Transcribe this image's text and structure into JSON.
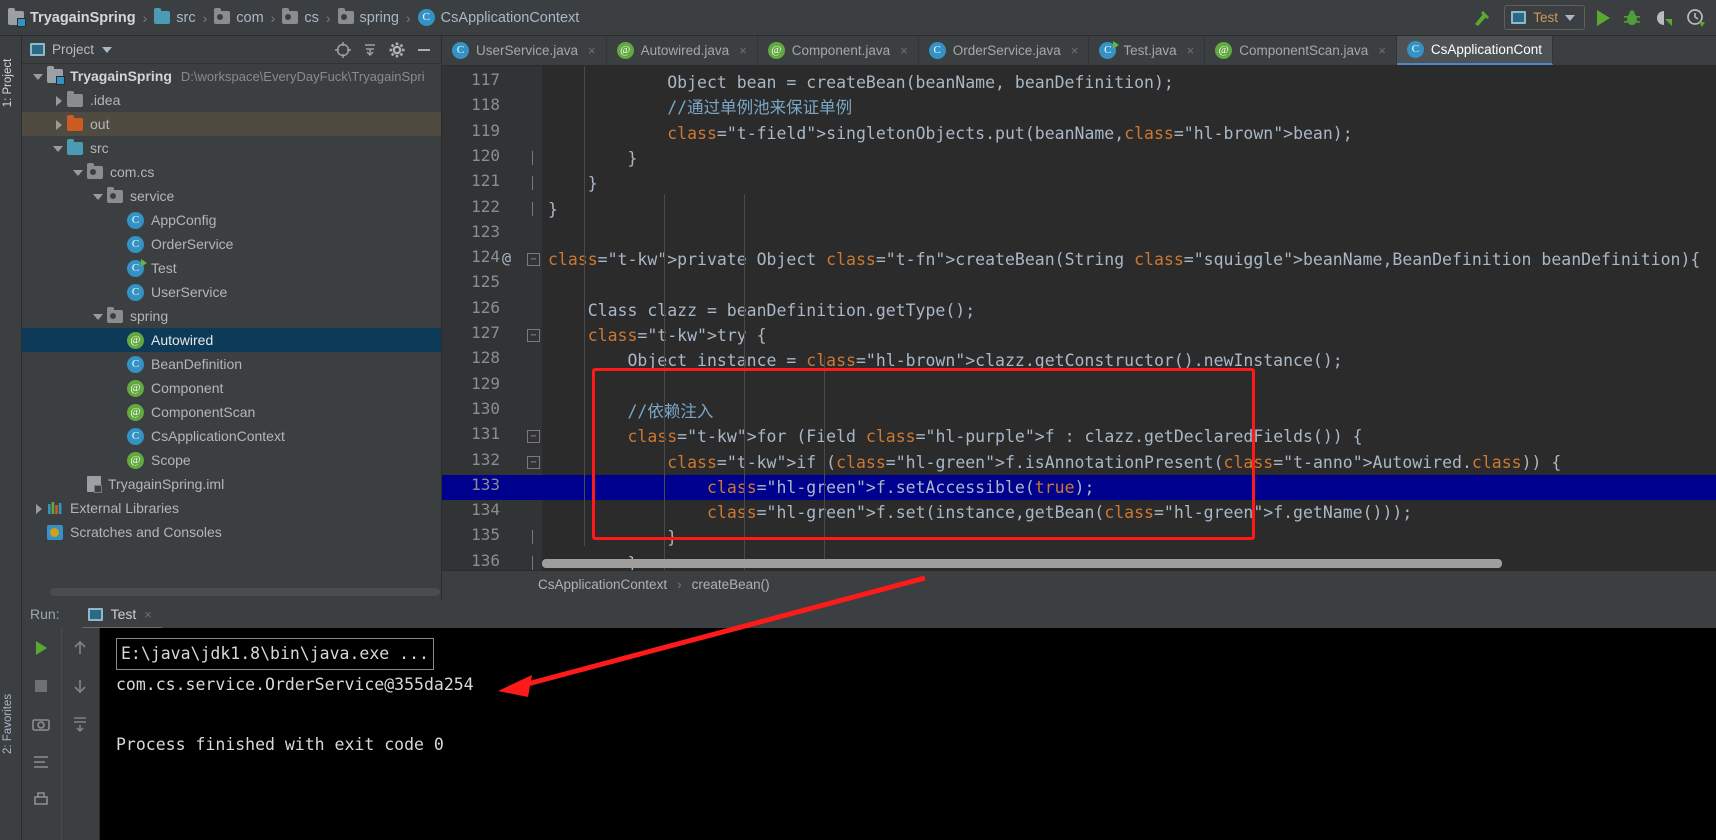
{
  "window": {
    "breadcrumbs": [
      {
        "label": "TryagainSpring",
        "icon": "module-root-icon"
      },
      {
        "label": "src",
        "icon": "folder-blue-icon"
      },
      {
        "label": "com",
        "icon": "package-icon"
      },
      {
        "label": "cs",
        "icon": "package-icon"
      },
      {
        "label": "spring",
        "icon": "package-icon"
      },
      {
        "label": "CsApplicationContext",
        "icon": "class-icon"
      }
    ],
    "separator": "›"
  },
  "toolbar": {
    "build_icon": "hammer-icon",
    "run_config": "Test",
    "run_config_icon": "run-config-icon",
    "dropdown_icon": "chevron-down-icon",
    "run_icon": "run-play-icon",
    "debug_icon": "debug-bug-icon",
    "run_coverage_icon": "run-coverage-icon",
    "profile_icon": "profiler-icon"
  },
  "left_strip": {
    "top_tab": "1: Project",
    "bottom_tab": "2: Favorites"
  },
  "project_panel": {
    "title": "Project",
    "title_caret": "chevron-down-icon",
    "header_icons": [
      "locate-icon",
      "collapse-all-icon",
      "settings-gear-icon",
      "hide-icon"
    ],
    "tree": [
      {
        "label": "TryagainSpring",
        "path": "D:\\workspace\\EveryDayFuck\\TryagainSpri",
        "indent": 0,
        "arrow": "open",
        "icon": "module-root-icon",
        "bold": true,
        "state": "none"
      },
      {
        "label": ".idea",
        "indent": 1,
        "arrow": "closed",
        "icon": "folder-gray-icon",
        "state": "none"
      },
      {
        "label": "out",
        "indent": 1,
        "arrow": "closed",
        "icon": "folder-orange-icon",
        "state": "gray"
      },
      {
        "label": "src",
        "indent": 1,
        "arrow": "open",
        "icon": "folder-blue-icon",
        "state": "none"
      },
      {
        "label": "com.cs",
        "indent": 2,
        "arrow": "open",
        "icon": "package-icon",
        "state": "none"
      },
      {
        "label": "service",
        "indent": 3,
        "arrow": "open",
        "icon": "package-icon",
        "state": "none"
      },
      {
        "label": "AppConfig",
        "indent": 4,
        "arrow": "none",
        "icon": "class-icon",
        "state": "none"
      },
      {
        "label": "OrderService",
        "indent": 4,
        "arrow": "none",
        "icon": "class-icon",
        "state": "none"
      },
      {
        "label": "Test",
        "indent": 4,
        "arrow": "none",
        "icon": "class-runnable-icon",
        "state": "none"
      },
      {
        "label": "UserService",
        "indent": 4,
        "arrow": "none",
        "icon": "class-icon",
        "state": "none"
      },
      {
        "label": "spring",
        "indent": 3,
        "arrow": "open",
        "icon": "package-icon",
        "state": "none"
      },
      {
        "label": "Autowired",
        "indent": 4,
        "arrow": "none",
        "icon": "annotation-icon",
        "state": "blue"
      },
      {
        "label": "BeanDefinition",
        "indent": 4,
        "arrow": "none",
        "icon": "class-icon",
        "state": "none"
      },
      {
        "label": "Component",
        "indent": 4,
        "arrow": "none",
        "icon": "annotation-icon",
        "state": "none"
      },
      {
        "label": "ComponentScan",
        "indent": 4,
        "arrow": "none",
        "icon": "annotation-icon",
        "state": "none"
      },
      {
        "label": "CsApplicationContext",
        "indent": 4,
        "arrow": "none",
        "icon": "class-icon",
        "state": "none"
      },
      {
        "label": "Scope",
        "indent": 4,
        "arrow": "none",
        "icon": "annotation-icon",
        "state": "none"
      },
      {
        "label": "TryagainSpring.iml",
        "indent": 2,
        "arrow": "none",
        "icon": "iml-file-icon",
        "state": "none"
      },
      {
        "label": "External Libraries",
        "indent": 0,
        "arrow": "closed",
        "icon": "library-icon",
        "state": "none"
      },
      {
        "label": "Scratches and Consoles",
        "indent": 0,
        "arrow": "none",
        "icon": "scratches-icon",
        "state": "none"
      }
    ]
  },
  "editor_tabs": [
    {
      "label": "UserService.java",
      "icon": "class-icon",
      "active": false,
      "close": "×"
    },
    {
      "label": "Autowired.java",
      "icon": "annotation-icon",
      "active": false,
      "close": "×"
    },
    {
      "label": "Component.java",
      "icon": "annotation-icon",
      "active": false,
      "close": "×"
    },
    {
      "label": "OrderService.java",
      "icon": "class-icon",
      "active": false,
      "close": "×"
    },
    {
      "label": "Test.java",
      "icon": "class-runnable-icon",
      "active": false,
      "close": "×"
    },
    {
      "label": "ComponentScan.java",
      "icon": "annotation-icon",
      "active": false,
      "close": "×"
    },
    {
      "label": "CsApplicationCont",
      "icon": "class-icon",
      "active": true,
      "close": ""
    }
  ],
  "editor": {
    "first_line": 117,
    "caret_line": 133,
    "lines": [
      {
        "n": 117,
        "text": "            Object bean = createBean(beanName, beanDefinition);"
      },
      {
        "n": 118,
        "text": "            //通过单例池来保证单例"
      },
      {
        "n": 119,
        "text": "            singletonObjects.put(beanName,bean);"
      },
      {
        "n": 120,
        "text": "        }"
      },
      {
        "n": 121,
        "text": "    }"
      },
      {
        "n": 122,
        "text": "}"
      },
      {
        "n": 123,
        "text": ""
      },
      {
        "n": 124,
        "text": "private Object createBean(String beanName,BeanDefinition beanDefinition){"
      },
      {
        "n": 125,
        "text": ""
      },
      {
        "n": 126,
        "text": "    Class clazz = beanDefinition.getType();"
      },
      {
        "n": 127,
        "text": "    try {"
      },
      {
        "n": 128,
        "text": "        Object instance = clazz.getConstructor().newInstance();"
      },
      {
        "n": 129,
        "text": ""
      },
      {
        "n": 130,
        "text": "        //依赖注入"
      },
      {
        "n": 131,
        "text": "        for (Field f : clazz.getDeclaredFields()) {"
      },
      {
        "n": 132,
        "text": "            if (f.isAnnotationPresent(Autowired.class)) {"
      },
      {
        "n": 133,
        "text": "                f.setAccessible(true);"
      },
      {
        "n": 134,
        "text": "                f.set(instance,getBean(f.getName()));"
      },
      {
        "n": 135,
        "text": "            }"
      },
      {
        "n": 136,
        "text": "        }"
      }
    ],
    "annotation_marker": "@",
    "highlights": {
      "bean_occurrence": "bean",
      "constructor_call": "clazz.getConstructor",
      "field_var": "f"
    }
  },
  "editor_breadcrumbs": {
    "items": [
      "CsApplicationContext",
      "createBean()"
    ],
    "separator": "›"
  },
  "run_panel": {
    "label": "Run:",
    "tab": "Test",
    "tab_icon": "run-config-icon",
    "tab_close": "×",
    "side_icons": [
      "rerun-play-icon",
      "stop-square-icon",
      "camera-icon",
      "soft-wrap-icon",
      "scroll-to-end-icon",
      "up-arrow-icon",
      "down-arrow-icon",
      "print-icon"
    ],
    "console": [
      {
        "text": "E:\\java\\jdk1.8\\bin\\java.exe ...",
        "boxed": true
      },
      {
        "text": "com.cs.service.OrderService@355da254",
        "boxed": false
      },
      {
        "text": "",
        "boxed": false
      },
      {
        "text": "Process finished with exit code 0",
        "boxed": false
      }
    ]
  },
  "annotations": {
    "red_box_label": "dependency-injection-highlight",
    "red_arrow_label": "output-callout-arrow",
    "accent_red": "#ff1a1a",
    "accent_blue": "#3592c4",
    "accent_green": "#62a93f"
  }
}
